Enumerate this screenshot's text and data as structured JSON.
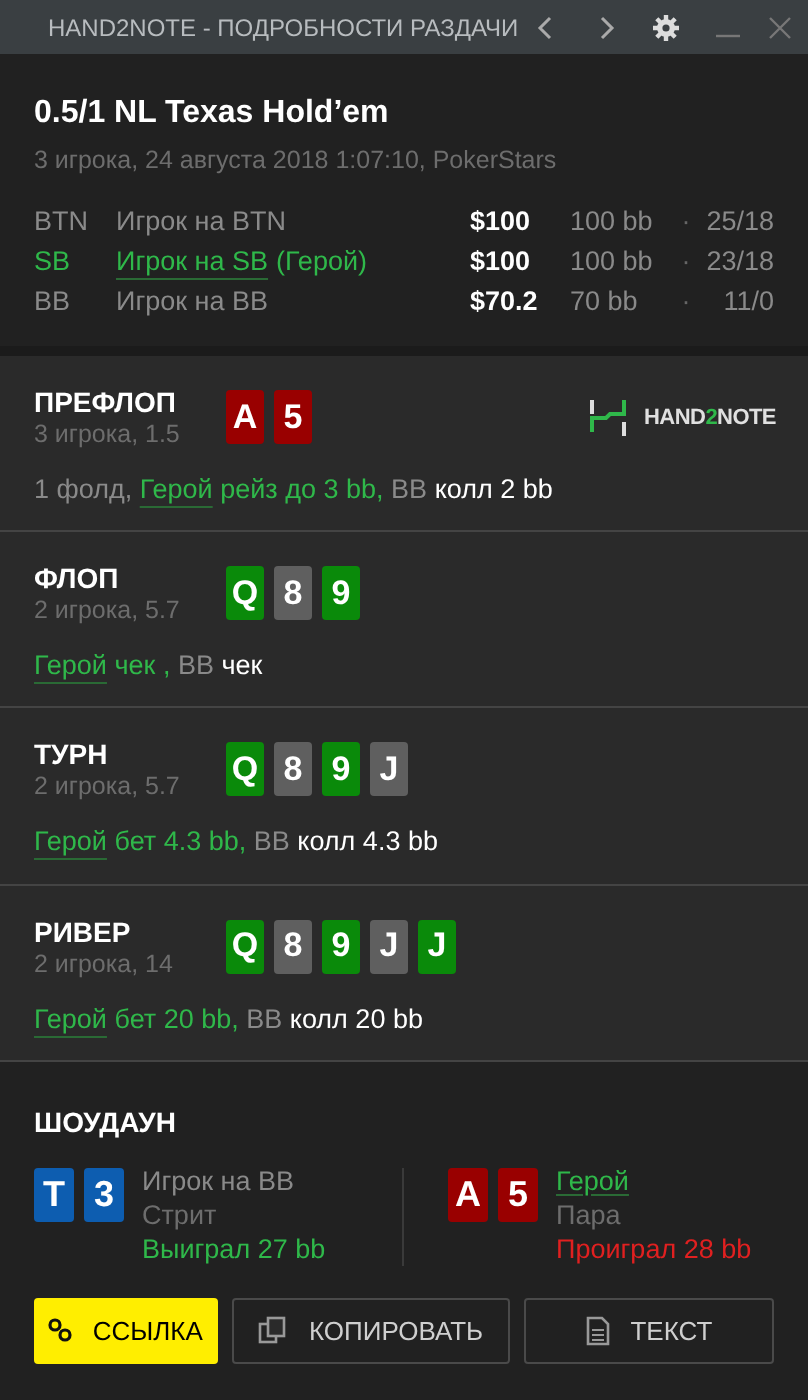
{
  "window": {
    "title": "HAND2NOTE - ПОДРОБНОСТИ РАЗДАЧИ"
  },
  "hand": {
    "title": "0.5/1 NL Texas Hold’em",
    "subtitle": "3 игрока, 24 августа 2018 1:07:10, PokerStars"
  },
  "players": [
    {
      "position": "BTN",
      "name": "Игрок на BTN",
      "hero": false,
      "stack": "$100",
      "bb": "100 bb",
      "separator": "·",
      "stats": "25/18"
    },
    {
      "position": "SB",
      "name": "Игрок на SB",
      "tag": "(Герой)",
      "hero": true,
      "stack": "$100",
      "bb": "100 bb",
      "separator": "·",
      "stats": "23/18"
    },
    {
      "position": "BB",
      "name": "Игрок на BB",
      "hero": false,
      "stack": "$70.2",
      "bb": "70 bb",
      "separator": "·",
      "stats": "11/0"
    }
  ],
  "logo": {
    "parts": [
      "HAND",
      "2",
      "NOTE"
    ]
  },
  "streets": [
    {
      "name": "ПРЕФЛОП",
      "info": "3 игрока, 1.5",
      "logo": true,
      "cards": [
        {
          "rank": "A",
          "color": "#990000"
        },
        {
          "rank": "5",
          "color": "#990000"
        }
      ],
      "actions": [
        {
          "kind": "dim",
          "text": "1 фолд,"
        },
        {
          "kind": "hero",
          "text": "Герой"
        },
        {
          "kind": "green",
          "text": "рейз до 3 bb,"
        },
        {
          "kind": "dim",
          "text": "BB"
        },
        {
          "kind": "white",
          "text": "колл 2 bb"
        }
      ]
    },
    {
      "name": "ФЛОП",
      "info": "2 игрока, 5.7",
      "logo": false,
      "cards": [
        {
          "rank": "Q",
          "color": "#0a8a0a"
        },
        {
          "rank": "8",
          "color": "#5f5f5f"
        },
        {
          "rank": "9",
          "color": "#0a8a0a"
        }
      ],
      "actions": [
        {
          "kind": "hero",
          "text": "Герой"
        },
        {
          "kind": "green",
          "text": "чек ,"
        },
        {
          "kind": "dim",
          "text": "BB"
        },
        {
          "kind": "white",
          "text": "чек"
        }
      ]
    },
    {
      "name": "ТУРН",
      "info": "2 игрока, 5.7",
      "logo": false,
      "cards": [
        {
          "rank": "Q",
          "color": "#0a8a0a"
        },
        {
          "rank": "8",
          "color": "#5f5f5f"
        },
        {
          "rank": "9",
          "color": "#0a8a0a"
        },
        {
          "rank": "J",
          "color": "#5f5f5f"
        }
      ],
      "actions": [
        {
          "kind": "hero",
          "text": "Герой"
        },
        {
          "kind": "green",
          "text": "бет 4.3 bb,"
        },
        {
          "kind": "dim",
          "text": "BB"
        },
        {
          "kind": "white",
          "text": "колл 4.3 bb"
        }
      ]
    },
    {
      "name": "РИВЕР",
      "info": "2 игрока, 14",
      "logo": false,
      "cards": [
        {
          "rank": "Q",
          "color": "#0a8a0a"
        },
        {
          "rank": "8",
          "color": "#5f5f5f"
        },
        {
          "rank": "9",
          "color": "#0a8a0a"
        },
        {
          "rank": "J",
          "color": "#5f5f5f"
        },
        {
          "rank": "J",
          "color": "#0a8a0a"
        }
      ],
      "actions": [
        {
          "kind": "hero",
          "text": "Герой"
        },
        {
          "kind": "green",
          "text": "бет 20 bb,"
        },
        {
          "kind": "dim",
          "text": "BB"
        },
        {
          "kind": "white",
          "text": "колл 20 bb"
        }
      ]
    }
  ],
  "showdown": {
    "title": "ШОУДАУН",
    "hands": [
      {
        "player": "Игрок на BB",
        "hero": false,
        "combo": "Стрит",
        "result": "Выиграл 27 bb",
        "won": true,
        "cards": [
          {
            "rank": "T",
            "color": "#0d5db0"
          },
          {
            "rank": "3",
            "color": "#0d5db0"
          }
        ]
      },
      {
        "player": "Герой",
        "hero": true,
        "combo": "Пара",
        "result": "Проиграл 28 bb",
        "won": false,
        "cards": [
          {
            "rank": "A",
            "color": "#990000"
          },
          {
            "rank": "5",
            "color": "#990000"
          }
        ]
      }
    ]
  },
  "buttons": [
    {
      "kind": "link",
      "label": "ССЫЛКА"
    },
    {
      "kind": "copy",
      "label": "КОПИРОВАТЬ"
    },
    {
      "kind": "text",
      "label": "ТЕКСТ"
    }
  ]
}
